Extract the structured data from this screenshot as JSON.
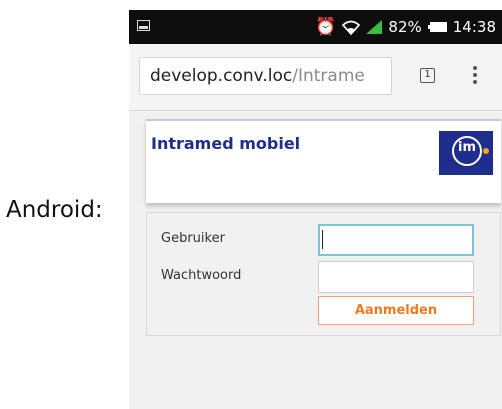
{
  "caption": "Android:",
  "status_bar": {
    "battery": "82%",
    "time": "14:38",
    "icons": [
      "screenshot-icon",
      "alarm-icon",
      "wifi-icon",
      "signal-icon",
      "battery-icon"
    ]
  },
  "address_bar": {
    "url_host": "develop.conv.loc",
    "url_path": "/Intrame",
    "tab_count": "1"
  },
  "page": {
    "title": "Intramed mobiel",
    "logo_text": "im",
    "login": {
      "user_label": "Gebruiker",
      "user_value": "",
      "pass_label": "Wachtwoord",
      "pass_value": "",
      "submit_label": "Aanmelden"
    }
  },
  "colors": {
    "title": "#1d2f8a",
    "logo_bg": "#1f2e8c",
    "button_text": "#f07a22",
    "button_border": "#f0a36f",
    "focus_border": "#7fc3dc"
  }
}
